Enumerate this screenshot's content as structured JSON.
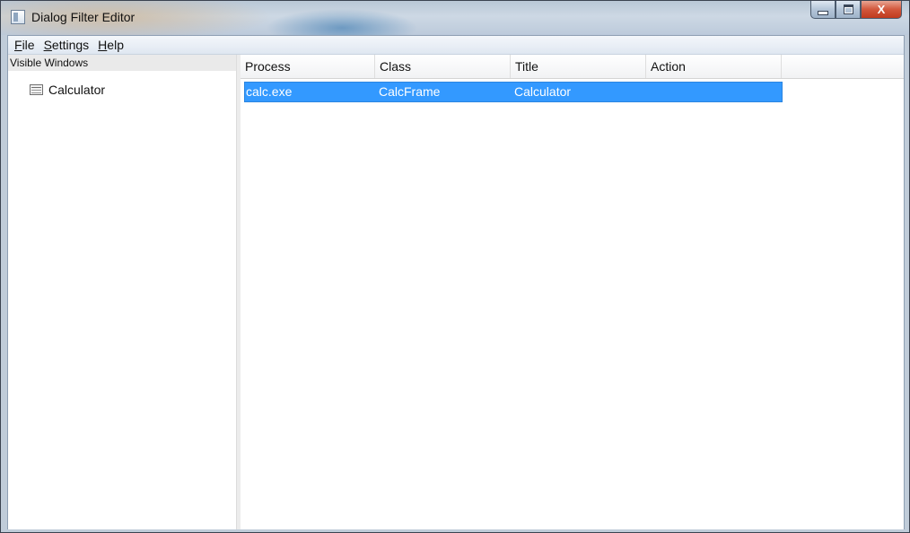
{
  "window": {
    "title": "Dialog Filter Editor",
    "caption_min": "",
    "caption_max": "",
    "caption_close": "X"
  },
  "menu": {
    "file": {
      "accel": "F",
      "rest": "ile"
    },
    "settings": {
      "accel": "S",
      "rest": "ettings"
    },
    "help": {
      "accel": "H",
      "rest": "elp"
    }
  },
  "sidebar": {
    "header": "Visible Windows",
    "items": [
      {
        "label": "Calculator",
        "icon": "window-icon"
      }
    ]
  },
  "table": {
    "columns": [
      "Process",
      "Class",
      "Title",
      "Action"
    ],
    "rows": [
      {
        "process": "calc.exe",
        "class": "CalcFrame",
        "title": "Calculator",
        "action": "",
        "selected": true
      }
    ]
  },
  "colors": {
    "selection": "#3399ff",
    "selection_text": "#ffffff"
  }
}
